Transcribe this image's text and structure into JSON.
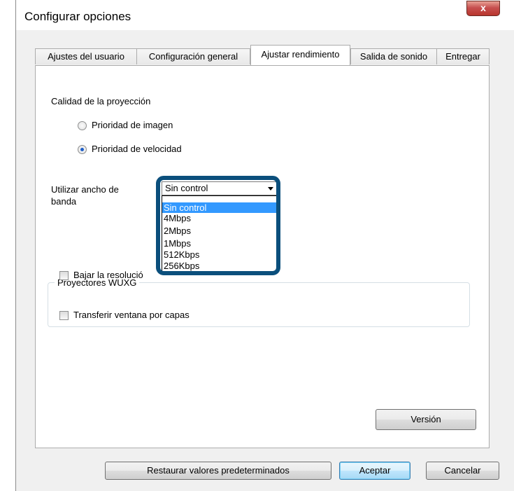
{
  "window": {
    "title": "Configurar opciones",
    "close_label": "x"
  },
  "tabs": [
    {
      "label": "Ajustes del usuario",
      "active": false
    },
    {
      "label": "Configuración general",
      "active": false
    },
    {
      "label": "Ajustar rendimiento",
      "active": true
    },
    {
      "label": "Salida de sonido",
      "active": false
    },
    {
      "label": "Entregar",
      "active": false
    }
  ],
  "quality": {
    "heading": "Calidad de la proyección",
    "options": [
      {
        "label": "Prioridad de imagen",
        "selected": false
      },
      {
        "label": "Prioridad de velocidad",
        "selected": true
      }
    ]
  },
  "bandwidth": {
    "label_line1": "Utilizar ancho de",
    "label_line2": "banda",
    "selected_value": "Sin control",
    "options": [
      "Sin control",
      "4Mbps",
      "2Mbps",
      "1Mbps",
      "512Kbps",
      "256Kbps"
    ],
    "highlight_color": "#0b4f7c"
  },
  "wuxga_group": {
    "legend": "Proyectores WUXG",
    "checkbox_label": "Bajar la resolució",
    "checked": false
  },
  "layered_window": {
    "label": "Transferir ventana por capas",
    "checked": false
  },
  "buttons": {
    "version": "Versión",
    "restore": "Restaurar valores predeterminados",
    "accept": "Aceptar",
    "cancel": "Cancelar"
  }
}
